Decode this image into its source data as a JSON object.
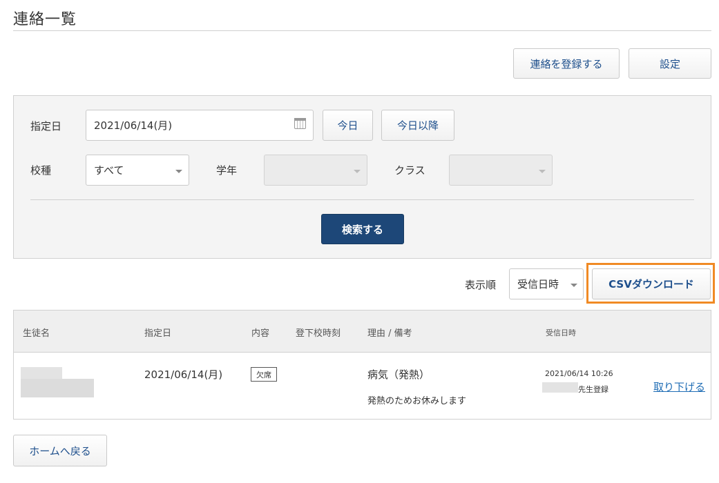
{
  "page_title": "連絡一覧",
  "toolbar": {
    "register_label": "連絡を登録する",
    "settings_label": "設定"
  },
  "search": {
    "date_label": "指定日",
    "date_value": "2021/06/14(月)",
    "today_label": "今日",
    "after_today_label": "今日以降",
    "school_type_label": "校種",
    "school_type_value": "すべて",
    "grade_label": "学年",
    "grade_value": "",
    "class_label": "クラス",
    "class_value": "",
    "submit_label": "検索する"
  },
  "sort": {
    "label": "表示順",
    "value": "受信日時",
    "csv_label": "CSVダウンロード"
  },
  "table": {
    "headers": {
      "student": "生徒名",
      "date": "指定日",
      "content": "内容",
      "time": "登下校時刻",
      "reason": "理由 / 備考",
      "received": "受信日時"
    },
    "rows": [
      {
        "date": "2021/06/14(月)",
        "content": "欠席",
        "reason": "病気（発熱）",
        "note": "発熱のためお休みします",
        "received_at": "2021/06/14 10:26",
        "registered_by": "先生登録",
        "action": "取り下げる"
      }
    ]
  },
  "footer": {
    "home_label": "ホームへ戻る"
  },
  "colors": {
    "primary": "#1d4778",
    "link": "#1f6db5",
    "highlight": "#f08a24"
  }
}
